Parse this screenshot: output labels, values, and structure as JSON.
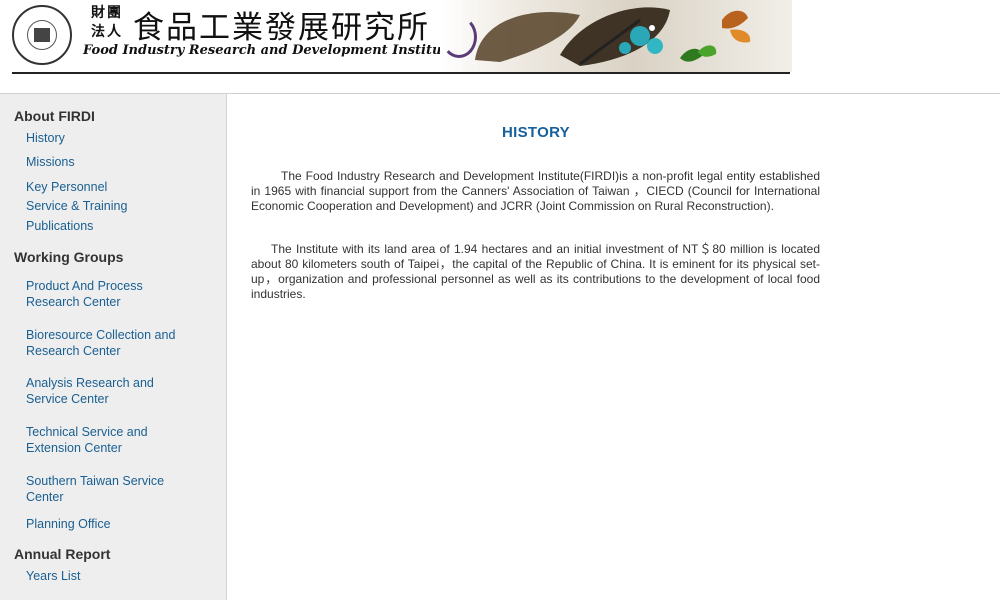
{
  "header": {
    "seal_text": "",
    "small_cn": "財團法人",
    "title_cn": "食品工業發展研究所",
    "title_en": "Food Industry Research and Development Institute"
  },
  "sidebar": {
    "about": {
      "title": "About FIRDI",
      "items": [
        "History",
        "Missions",
        "Key Personnel",
        "Service & Training",
        "Publications"
      ]
    },
    "groups": {
      "title": "Working Groups",
      "items": [
        "Product And Process Research Center",
        "Bioresource Collection and Research Center",
        "Analysis Research and Service Center",
        "Technical Service and Extension Center",
        "Southern Taiwan Service Center",
        "Planning Office"
      ]
    },
    "annual": {
      "title": "Annual Report",
      "items": [
        "Years List"
      ]
    }
  },
  "main": {
    "title": "HISTORY",
    "paragraphs": [
      "The Food Industry Research and Development Institute(FIRDI)is a non-profit legal entity established in 1965 with financial support from the Canners' Association of Taiwan ，CIECD (Council for International Economic Cooperation and Development) and JCRR (Joint Commission on Rural Reconstruction).",
      "The Institute with its land area of 1.94 hectares and an initial investment of NT＄80 million is located about 80 kilometers south of Taipei，the capital of the Republic of China. It is eminent for its physical set-up，organization and professional personnel as well as its contributions to the development of local food industries."
    ]
  },
  "colors": {
    "link": "#1a5f91",
    "title": "#17609c",
    "sidebar_bg": "#eeeeee"
  }
}
